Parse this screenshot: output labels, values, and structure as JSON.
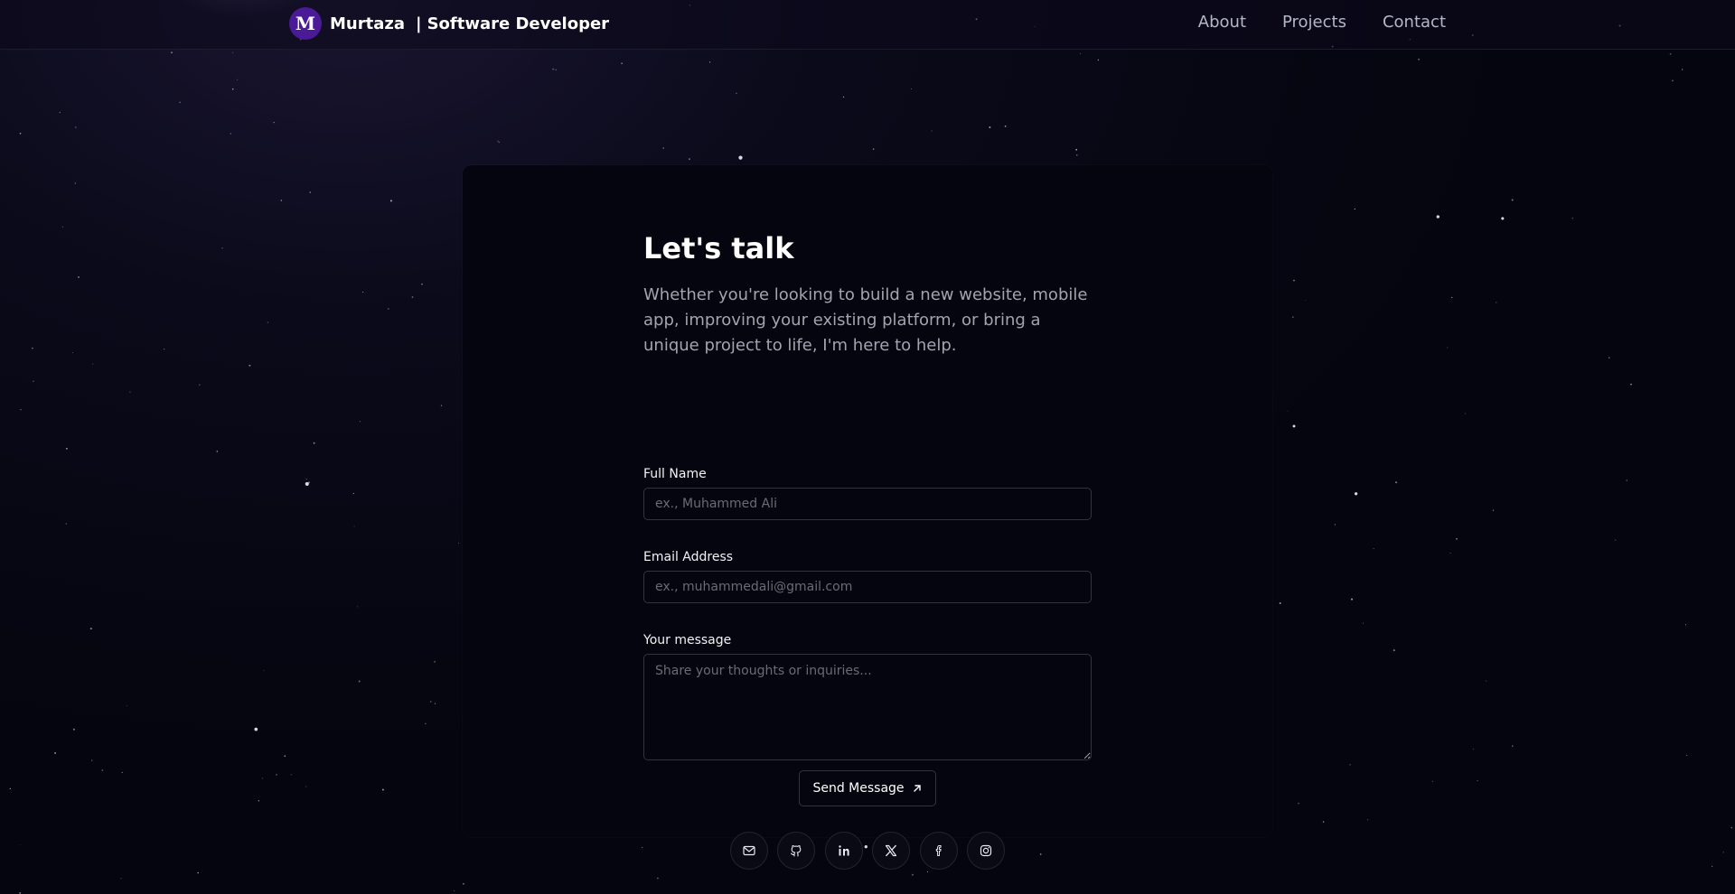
{
  "header": {
    "logo_letter": "M",
    "name": "Murtaza",
    "separator": "|",
    "role": "Software Developer",
    "nav": [
      {
        "label": "About"
      },
      {
        "label": "Projects"
      },
      {
        "label": "Contact"
      }
    ]
  },
  "contact": {
    "title": "Let's talk",
    "subtitle": "Whether you're looking to build a new website, mobile app, improving your existing platform, or bring a unique project to life, I'm here to help.",
    "fields": {
      "name": {
        "label": "Full Name",
        "placeholder": "ex., Muhammed Ali",
        "value": ""
      },
      "email": {
        "label": "Email Address",
        "placeholder": "ex., muhammedali@gmail.com",
        "value": ""
      },
      "message": {
        "label": "Your message",
        "placeholder": "Share your thoughts or inquiries...",
        "value": ""
      }
    },
    "send_label": "Send Message",
    "send_icon": "arrow-up-right-icon",
    "socials": [
      {
        "icon": "mail-icon"
      },
      {
        "icon": "github-icon"
      },
      {
        "icon": "linkedin-icon"
      },
      {
        "icon": "x-twitter-icon"
      },
      {
        "icon": "facebook-icon"
      },
      {
        "icon": "instagram-icon"
      }
    ]
  },
  "colors": {
    "background": "#05050f",
    "logo_bg": "#4b1a96",
    "nav_text": "#b4b6c6",
    "subtitle_text": "#a3a3b2",
    "border": "#34343f"
  }
}
